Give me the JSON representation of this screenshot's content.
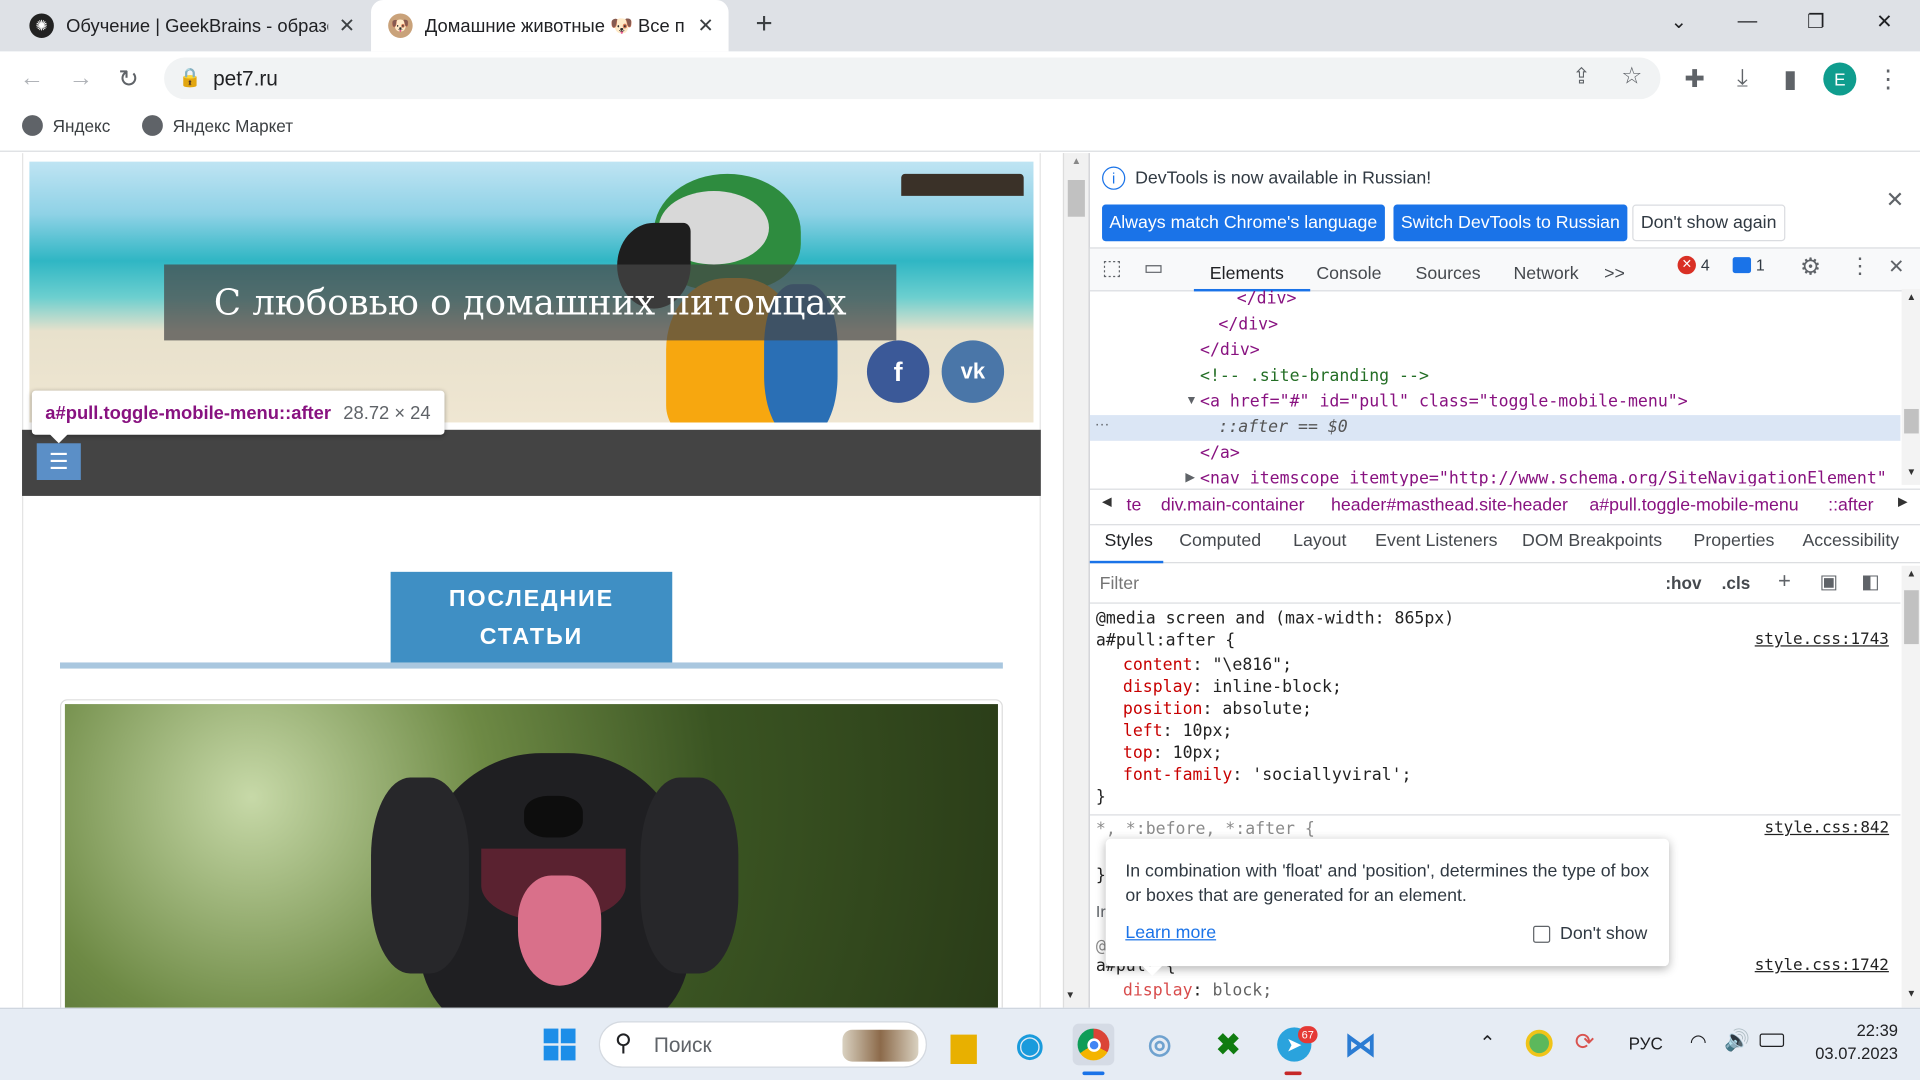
{
  "browser": {
    "tabs": [
      {
        "title": "Обучение | GeekBrains - образо",
        "active": false
      },
      {
        "title": "Домашние животные 🐶 Все пр",
        "active": true
      }
    ],
    "new_tab": "+",
    "url": "pet7.ru",
    "profile_initial": "E",
    "bookmarks": [
      "Яндекс",
      "Яндекс Маркет"
    ]
  },
  "page": {
    "hero_title": "С любовью о домашних питомцах",
    "social": {
      "facebook": "f",
      "vk": "vk"
    },
    "inspect_tooltip": {
      "selector": "a#pull.toggle-mobile-menu::after",
      "size": "28.72 × 24"
    },
    "latest_line1": "ПОСЛЕДНИЕ",
    "latest_line2": "СТАТЬИ"
  },
  "devtools": {
    "banner": "DevTools is now available in Russian!",
    "btn_match": "Always match Chrome's language",
    "btn_switch": "Switch DevTools to Russian",
    "btn_dont": "Don't show again",
    "tabs": [
      "Elements",
      "Console",
      "Sources",
      "Network",
      ">>"
    ],
    "errors": "4",
    "messages": "1",
    "dom_lines": [
      "</div>",
      "</div>",
      "</div>",
      "<!-- .site-branding -->",
      "<a href=\"#\" id=\"pull\" class=\"toggle-mobile-menu\">",
      "::after == $0",
      "</a>",
      "<nav itemscope itemtype=\"http://www.schema.org/SiteNavigationElement\""
    ],
    "breadcrumbs": [
      "te",
      "div.main-container",
      "header#masthead.site-header",
      "a#pull.toggle-mobile-menu",
      "::after"
    ],
    "style_tabs": [
      "Styles",
      "Computed",
      "Layout",
      "Event Listeners",
      "DOM Breakpoints",
      "Properties",
      "Accessibility"
    ],
    "filter_placeholder": "Filter",
    "hov": ":hov",
    "cls": ".cls",
    "media": "@media screen and (max-width: 865px)",
    "rule1": {
      "selector": "a#pull:after {",
      "source": "style.css:1743",
      "decls": [
        [
          "content",
          "\"\\e816\";"
        ],
        [
          "display",
          "inline-block;"
        ],
        [
          "position",
          "absolute;"
        ],
        [
          "left",
          "10px;"
        ],
        [
          "top",
          "10px;"
        ],
        [
          "font-family",
          "'sociallyviral';"
        ]
      ]
    },
    "rule2": {
      "selector": "*, *:before, *:after {",
      "source": "style.css:842"
    },
    "rule3": {
      "selector": "a#pull {",
      "source": "style.css:1742",
      "decl_name": "display",
      "decl_value": "block;"
    },
    "popup_text": "In combination with 'float' and 'position', determines the type of box or boxes that are generated for an element.",
    "popup_link": "Learn more",
    "popup_dontshow": "Don't show"
  },
  "taskbar": {
    "search_placeholder": "Поиск",
    "telegram_badge": "67",
    "lang": "РУС",
    "time": "22:39",
    "date": "03.07.2023"
  },
  "colors": {
    "accent": "#1a73e8",
    "menu_blue": "#3f8fc4",
    "facebook": "#3b5998",
    "vk": "#4a76a8"
  }
}
